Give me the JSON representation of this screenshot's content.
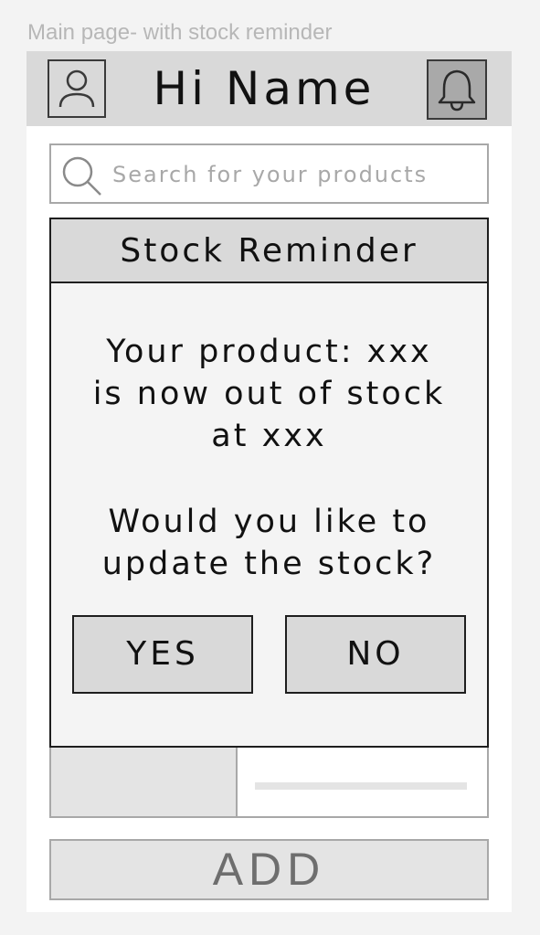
{
  "frame_label": "Main page- with stock reminder",
  "header": {
    "greeting": "Hi Name",
    "avatar_icon": "user-icon",
    "notification_icon": "bell-icon"
  },
  "search": {
    "placeholder": "Search for your products",
    "value": "",
    "icon": "search-icon"
  },
  "stock_reminder": {
    "title": "Stock Reminder",
    "message_lines": [
      "Your product: xxx",
      "is now out of stock",
      "at xxx"
    ],
    "question_lines": [
      "Would you like to",
      "update the stock?"
    ],
    "yes_label": "YES",
    "no_label": "NO"
  },
  "add_button_label": "ADD",
  "colors": {
    "header_bg": "#d9d9d9",
    "bell_bg": "#a9a9a9",
    "modal_bg": "#f4f4f4",
    "button_bg": "#d9d9d9",
    "placeholder_gray": "#a8a8a8"
  }
}
